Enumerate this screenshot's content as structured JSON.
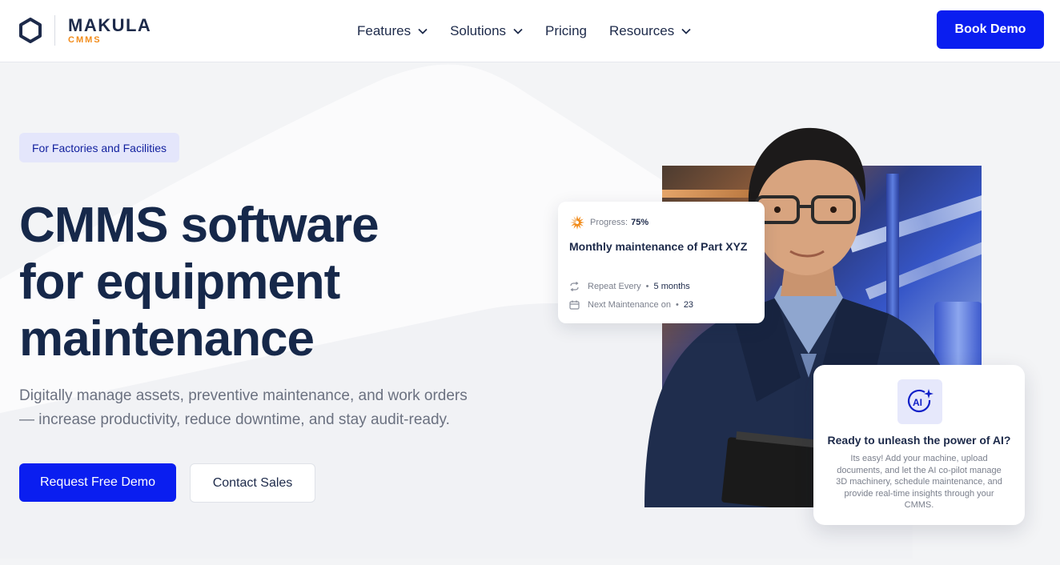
{
  "brand": {
    "name": "MAKULA",
    "sub": "CMMS",
    "name_color": "#1d2a4a",
    "sub_color": "#f28c1b"
  },
  "nav": {
    "items": [
      {
        "label": "Features",
        "has_dropdown": true
      },
      {
        "label": "Solutions",
        "has_dropdown": true
      },
      {
        "label": "Pricing",
        "has_dropdown": false
      },
      {
        "label": "Resources",
        "has_dropdown": true
      }
    ],
    "cta_label": "Book Demo"
  },
  "hero": {
    "badge": "For Factories and Facilities",
    "headline": [
      "CMMS software",
      "for equipment",
      "maintenance"
    ],
    "subtext_lines": [
      "Digitally manage assets, preventive maintenance, and work orders",
      "— increase productivity, reduce downtime, and stay audit-ready."
    ],
    "primary_cta": "Request Free Demo",
    "secondary_cta": "Contact Sales"
  },
  "progress_card": {
    "progress_label": "Progress:",
    "progress_value": "75%",
    "progress_fraction": 0.75,
    "title": "Monthly maintenance of Part XYZ",
    "repeat_label": "Repeat Every",
    "repeat_value": "5 months",
    "next_label": "Next Maintenance on",
    "next_value": "23"
  },
  "ai_card": {
    "icon_text": "AI",
    "title": "Ready to unleash the power of AI?",
    "body": "Its easy! Add your machine, upload documents, and let the AI co-pilot manage 3D machinery, schedule maintenance, and provide real-time insights through your CMMS."
  },
  "colors": {
    "accent": "#0a1ef0",
    "heading": "#16284a",
    "badge_bg": "#e4e6fb",
    "badge_text": "#101f9e"
  }
}
